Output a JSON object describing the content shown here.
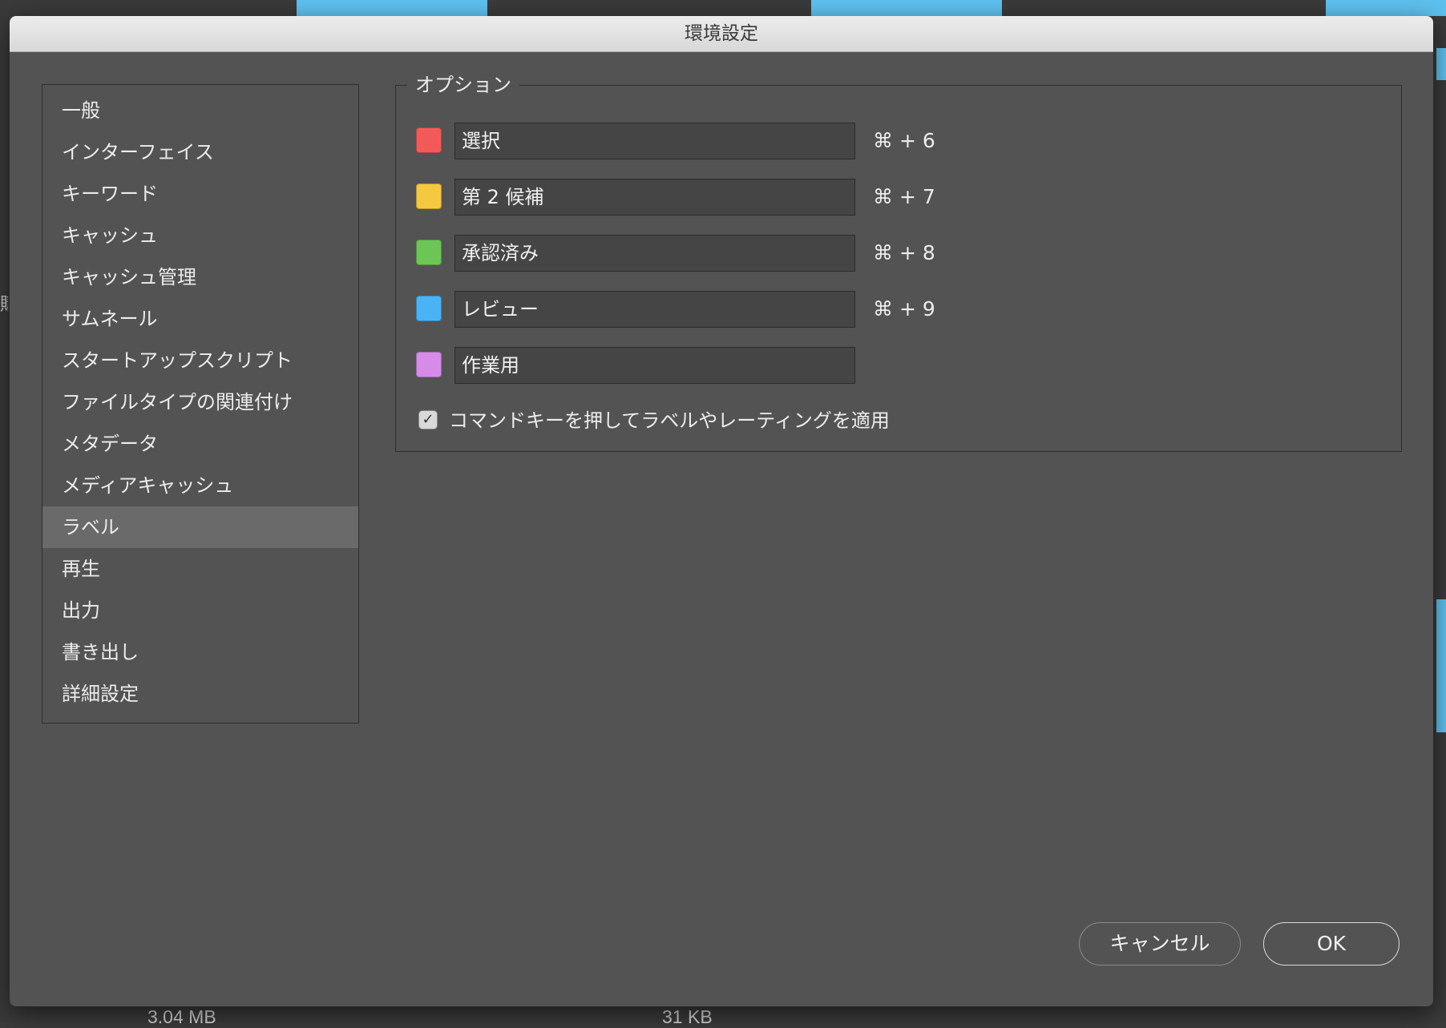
{
  "background": {
    "file_sizes": [
      "3.04 MB",
      "31 KB"
    ],
    "edge_glyph": "購"
  },
  "dialog": {
    "title": "環境設定"
  },
  "sidebar": {
    "items": [
      {
        "label": "一般"
      },
      {
        "label": "インターフェイス"
      },
      {
        "label": "キーワード"
      },
      {
        "label": "キャッシュ"
      },
      {
        "label": "キャッシュ管理"
      },
      {
        "label": "サムネール"
      },
      {
        "label": "スタートアップスクリプト"
      },
      {
        "label": "ファイルタイプの関連付け"
      },
      {
        "label": "メタデータ"
      },
      {
        "label": "メディアキャッシュ"
      },
      {
        "label": "ラベル",
        "selected": true
      },
      {
        "label": "再生"
      },
      {
        "label": "出力"
      },
      {
        "label": "書き出し"
      },
      {
        "label": "詳細設定"
      }
    ]
  },
  "options": {
    "legend": "オプション",
    "labels": [
      {
        "color": "#f25a5a",
        "value": "選択",
        "shortcut": "⌘ + 6"
      },
      {
        "color": "#f5c842",
        "value": "第 2 候補",
        "shortcut": "⌘ + 7"
      },
      {
        "color": "#6cc655",
        "value": "承認済み",
        "shortcut": "⌘ + 8"
      },
      {
        "color": "#4ab3f4",
        "value": "レビュー",
        "shortcut": "⌘ + 9"
      },
      {
        "color": "#d68be8",
        "value": "作業用",
        "shortcut": ""
      }
    ],
    "command_key_checkbox": {
      "checked": true,
      "check_glyph": "✓",
      "label": "コマンドキーを押してラベルやレーティングを適用"
    }
  },
  "buttons": {
    "cancel": "キャンセル",
    "ok": "OK"
  }
}
